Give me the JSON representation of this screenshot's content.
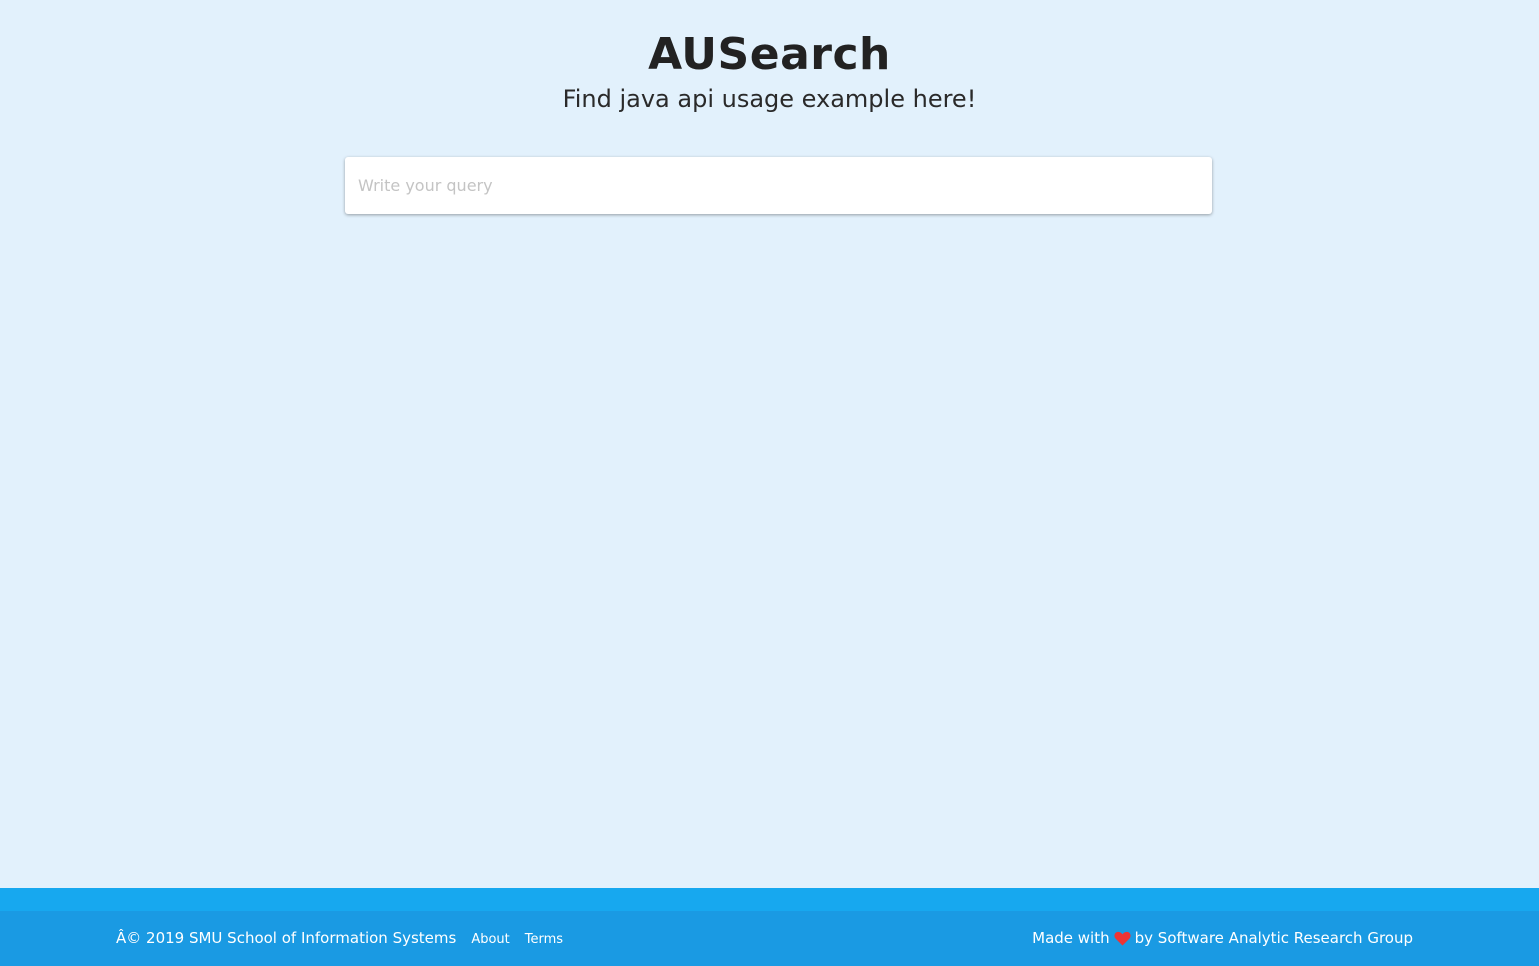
{
  "header": {
    "title": "AUSearch",
    "subtitle": "Find java api usage example here!"
  },
  "search": {
    "placeholder": "Write your query",
    "value": ""
  },
  "footer": {
    "copyright": "Â© 2019 SMU School of Information Systems",
    "links": [
      "About",
      "Terms"
    ],
    "made_with_prefix": "Made with",
    "made_with_icon": "heart-icon",
    "made_with_suffix": "by Software Analytic Research Group"
  },
  "colors": {
    "background": "#e2f1fc",
    "footer_strip": "#17a8ef",
    "footer": "#1a9ae3",
    "heart": "#ee3333"
  }
}
